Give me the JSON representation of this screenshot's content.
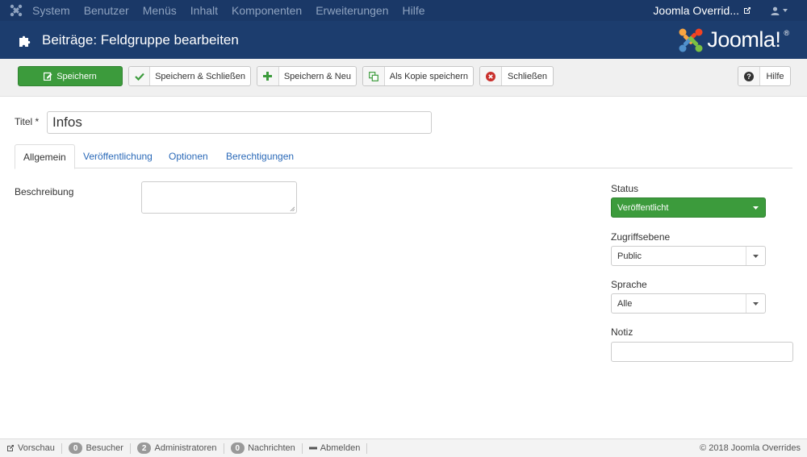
{
  "topnav": {
    "menu": [
      "System",
      "Benutzer",
      "Menüs",
      "Inhalt",
      "Komponenten",
      "Erweiterungen",
      "Hilfe"
    ],
    "site_link": "Joomla Overrid..."
  },
  "header": {
    "title": "Beiträge: Feldgruppe bearbeiten",
    "brand": "Joomla!",
    "brand_mark": "®"
  },
  "toolbar": {
    "save": "Speichern",
    "save_close": "Speichern & Schließen",
    "save_new": "Speichern & Neu",
    "save_copy": "Als Kopie speichern",
    "close": "Schließen",
    "help": "Hilfe"
  },
  "form": {
    "title_label": "Titel *",
    "title_value": "Infos",
    "tabs": [
      "Allgemein",
      "Veröffentlichung",
      "Optionen",
      "Berechtigungen"
    ],
    "description_label": "Beschreibung",
    "description_value": ""
  },
  "sidebar": {
    "status_label": "Status",
    "status_value": "Veröffentlicht",
    "access_label": "Zugriffsebene",
    "access_value": "Public",
    "language_label": "Sprache",
    "language_value": "Alle",
    "note_label": "Notiz",
    "note_value": ""
  },
  "statusbar": {
    "preview": "Vorschau",
    "visitors_count": "0",
    "visitors": "Besucher",
    "admins_count": "2",
    "admins": "Administratoren",
    "messages_count": "0",
    "messages": "Nachrichten",
    "logout": "Abmelden",
    "copyright": "© 2018 Joomla Overrides"
  },
  "colors": {
    "nav_bg": "#1a3867",
    "header_bg": "#1c3d6e",
    "success": "#3c9b3c",
    "link": "#2a69b8"
  },
  "icons": [
    "joomla-icon",
    "external-link-icon",
    "user-icon",
    "puzzle-icon",
    "edit-icon",
    "check-icon",
    "plus-icon",
    "copy-icon",
    "close-circle-icon",
    "help-icon",
    "caret-down-icon",
    "minus-icon"
  ]
}
